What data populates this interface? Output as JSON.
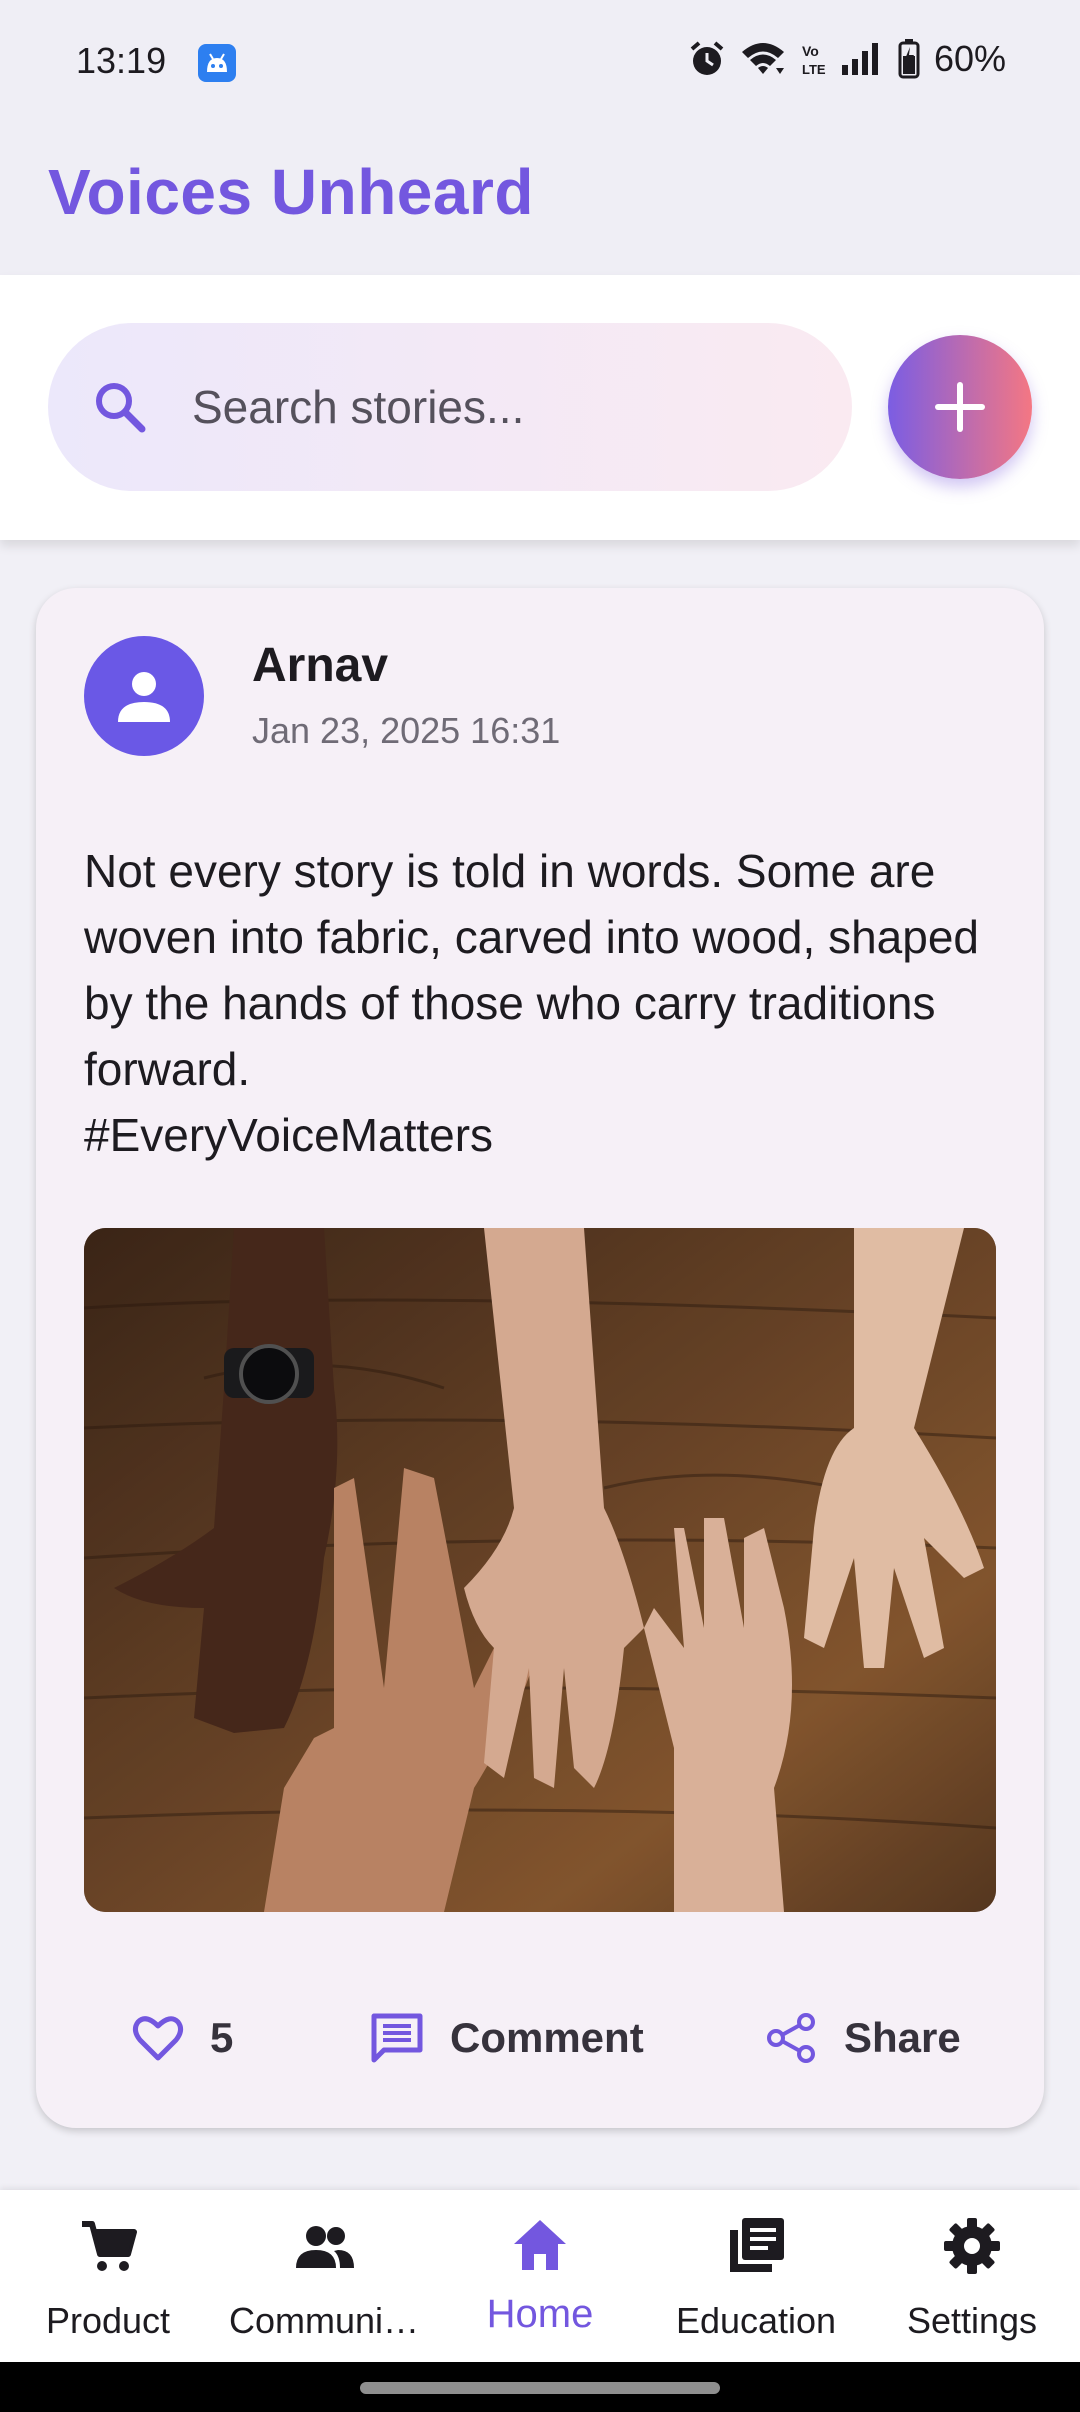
{
  "status_bar": {
    "time": "13:19",
    "battery": "60%",
    "icons": [
      "android-notification-icon",
      "alarm-icon",
      "wifi-icon",
      "volte-icon",
      "signal-icon",
      "battery-icon"
    ]
  },
  "app": {
    "title": "Voices Unheard",
    "accent_color": "#7357df"
  },
  "search": {
    "placeholder": "Search stories...",
    "value": ""
  },
  "fab": {
    "icon": "plus-icon",
    "gradient": [
      "#7b5de3",
      "#f47783"
    ]
  },
  "post": {
    "author": "Arnav",
    "date": "Jan 23, 2025 16:31",
    "body": "Not every story is told in words. Some are woven into fabric, carved into wood, shaped by the hands of those who carry traditions forward.\n#EveryVoiceMatters",
    "likes": "5",
    "comment_label": "Comment",
    "share_label": "Share"
  },
  "bottom_nav": {
    "items": [
      {
        "label": "Product",
        "icon": "cart-icon"
      },
      {
        "label": "Communi…",
        "icon": "people-icon"
      },
      {
        "label": "Home",
        "icon": "home-icon",
        "active": true
      },
      {
        "label": "Education",
        "icon": "library-icon"
      },
      {
        "label": "Settings",
        "icon": "gear-icon"
      }
    ]
  }
}
